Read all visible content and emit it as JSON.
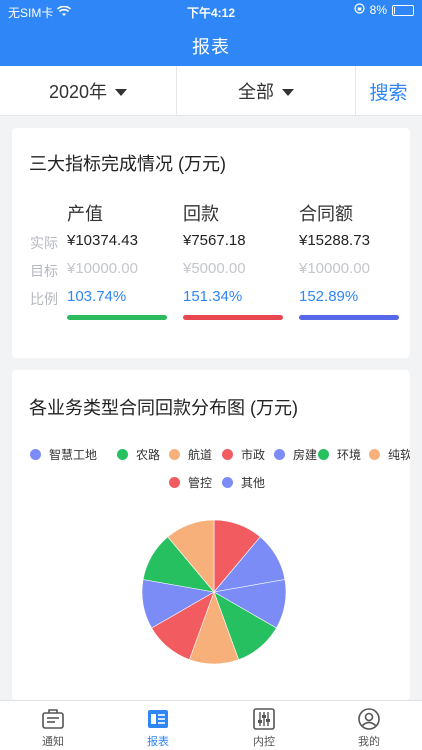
{
  "status_bar": {
    "carrier": "无SIM卡",
    "time": "下午4:12",
    "battery": "8%",
    "battery_level": 0.08
  },
  "header": {
    "title": "报表"
  },
  "filter": {
    "year": "2020年",
    "scope": "全部",
    "search_label": "搜索"
  },
  "indicators": {
    "title": "三大指标完成情况 (万元)",
    "row_labels": [
      "实际",
      "目标",
      "比例"
    ],
    "columns": [
      {
        "name": "产值",
        "actual": "¥10374.43",
        "target": "¥10000.00",
        "ratio": "103.74%",
        "color": "#2dbb5f"
      },
      {
        "name": "回款",
        "actual": "¥7567.18",
        "target": "¥5000.00",
        "ratio": "151.34%",
        "color": "#e8474f"
      },
      {
        "name": "合同额",
        "actual": "¥15288.73",
        "target": "¥10000.00",
        "ratio": "152.89%",
        "color": "#5468e8"
      }
    ]
  },
  "distribution": {
    "title": "各业务类型合同回款分布图 (万元)",
    "legend": [
      {
        "label": "智慧工地",
        "color": "#7b8cf7"
      },
      {
        "label": "农路",
        "color": "#26c061"
      },
      {
        "label": "航道",
        "color": "#f7b07a"
      },
      {
        "label": "市政",
        "color": "#f25c61"
      },
      {
        "label": "房建",
        "color": "#7b8cf7"
      },
      {
        "label": "环境",
        "color": "#26c061"
      },
      {
        "label": "纯软",
        "color": "#f7b07a"
      },
      {
        "label": "管控",
        "color": "#f25c61"
      },
      {
        "label": "其他",
        "color": "#7b8cf7"
      }
    ]
  },
  "chart_data": {
    "type": "pie",
    "title": "各业务类型合同回款分布图 (万元)",
    "categories": [
      "智慧工地",
      "农路",
      "航道",
      "市政",
      "房建",
      "环境",
      "纯软",
      "管控",
      "其他"
    ],
    "values": [
      1,
      1,
      1,
      1,
      1,
      1,
      1,
      1,
      1
    ],
    "colors": [
      "#f25c61",
      "#7b8cf7",
      "#7b8cf7",
      "#26c061",
      "#f7b07a",
      "#f25c61",
      "#7b8cf7",
      "#26c061",
      "#f7b07a"
    ],
    "legend_position": "top"
  },
  "tabbar": {
    "tabs": [
      {
        "label": "通知",
        "icon": "notice-icon"
      },
      {
        "label": "报表",
        "icon": "report-icon"
      },
      {
        "label": "内控",
        "icon": "control-icon"
      },
      {
        "label": "我的",
        "icon": "user-icon"
      }
    ],
    "active_index": 1,
    "active_color": "#2f86f6"
  }
}
